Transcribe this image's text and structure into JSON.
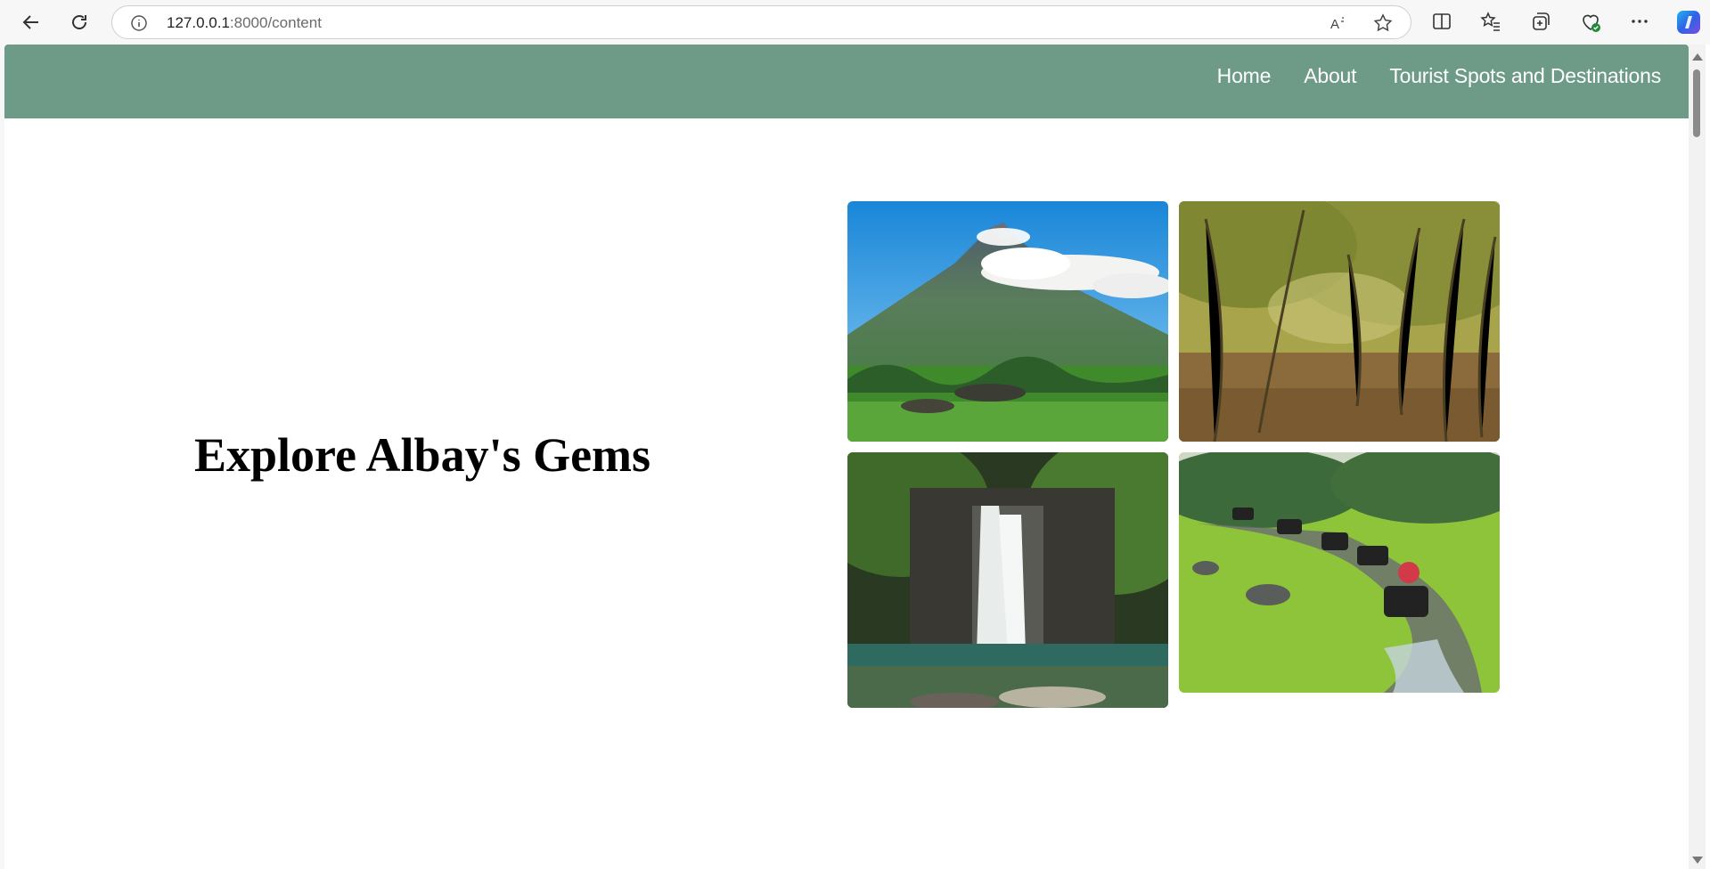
{
  "browser": {
    "url_host": "127.0.0.1",
    "url_rest": ":8000/content",
    "icons": [
      "back-icon",
      "refresh-icon",
      "info-icon",
      "read-aloud-icon",
      "favorite-star-icon",
      "split-screen-icon",
      "favorites-icon",
      "collections-icon",
      "browser-essentials-icon",
      "more-icon",
      "copilot-icon"
    ]
  },
  "navbar": {
    "links": [
      {
        "label": "Home"
      },
      {
        "label": "About"
      },
      {
        "label": "Tourist Spots and Destinations"
      }
    ],
    "color": "#6d9b88"
  },
  "hero": {
    "title": "Explore Albay's Gems"
  },
  "gallery": [
    {
      "subject": "volcano"
    },
    {
      "subject": "forest"
    },
    {
      "subject": "waterfall"
    },
    {
      "subject": "atv-trail"
    }
  ]
}
